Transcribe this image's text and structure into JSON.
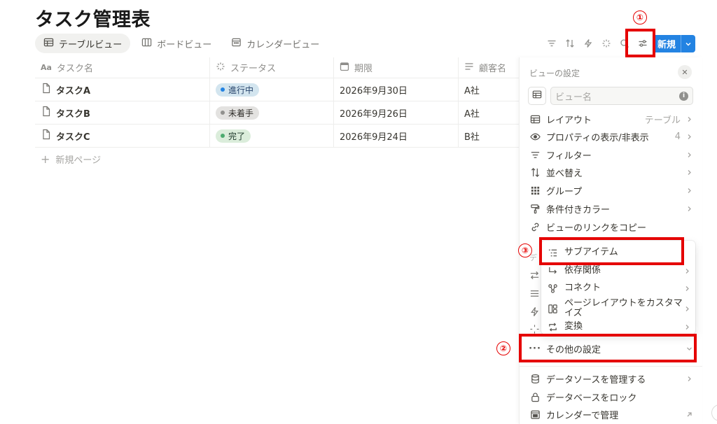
{
  "page_title": "タスク管理表",
  "tabs": [
    {
      "label": "テーブルビュー",
      "icon": "table-icon",
      "active": true
    },
    {
      "label": "ボードビュー",
      "icon": "board-icon",
      "active": false
    },
    {
      "label": "カレンダービュー",
      "icon": "calendar-icon",
      "active": false
    }
  ],
  "toolbar": {
    "icons": [
      "filter-icon",
      "sort-icon",
      "automation-icon",
      "sparkle-icon",
      "search-icon",
      "view-settings-icon"
    ],
    "new_label": "新規"
  },
  "table": {
    "columns": [
      {
        "label": "タスク名",
        "icon": "text-aa-icon"
      },
      {
        "label": "ステータス",
        "icon": "status-icon"
      },
      {
        "label": "期限",
        "icon": "date-icon"
      },
      {
        "label": "顧客名",
        "icon": "text-lines-icon"
      }
    ],
    "rows": [
      {
        "name": "タスクA",
        "status": "進行中",
        "due": "2026年9月30日",
        "client": "A社"
      },
      {
        "name": "タスクB",
        "status": "未着手",
        "due": "2026年9月26日",
        "client": "A社"
      },
      {
        "name": "タスクC",
        "status": "完了",
        "due": "2026年9月24日",
        "client": "B社"
      }
    ],
    "add_row_label": "新規ページ"
  },
  "status_colors": {
    "進行中": {
      "bg": "#d3e5ef",
      "dot": "#2383e2"
    },
    "未着手": {
      "bg": "#e3e2e0",
      "dot": "#91918e"
    },
    "完了": {
      "bg": "#dbeddb",
      "dot": "#4dab6f"
    }
  },
  "panel": {
    "title": "ビューの設定",
    "name_placeholder": "ビュー名",
    "items": [
      {
        "label": "レイアウト",
        "value": "テーブル",
        "icon": "table-icon"
      },
      {
        "label": "プロパティの表示/非表示",
        "value": "4",
        "icon": "eye-icon"
      },
      {
        "label": "フィルター",
        "value": "",
        "icon": "filter-icon"
      },
      {
        "label": "並べ替え",
        "value": "",
        "icon": "sort-icon"
      },
      {
        "label": "グループ",
        "value": "",
        "icon": "group-icon"
      },
      {
        "label": "条件付きカラー",
        "value": "",
        "icon": "paint-roller-icon"
      },
      {
        "label": "ビューのリンクをコピー",
        "value": "",
        "icon": "link-icon"
      }
    ],
    "more_settings_label": "その他の設定",
    "bottom_items": [
      {
        "label": "データソースを管理する",
        "icon": "database-icon"
      },
      {
        "label": "データベースをロック",
        "icon": "lock-icon"
      },
      {
        "label": "カレンダーで管理",
        "icon": "calendar-manage-icon"
      }
    ]
  },
  "submenu": {
    "items": [
      {
        "label": "サブアイテム",
        "icon": "sub-items-icon"
      },
      {
        "label": "依存関係",
        "icon": "dependency-arrow-icon"
      },
      {
        "label": "コネクト",
        "icon": "connect-icon"
      },
      {
        "label": "ページレイアウトをカスタマイズ",
        "icon": "page-layout-icon"
      },
      {
        "label": "変換",
        "icon": "convert-icon"
      }
    ]
  },
  "annotations": {
    "markers": [
      "①",
      "②",
      "③"
    ],
    "color": "#e50000"
  }
}
